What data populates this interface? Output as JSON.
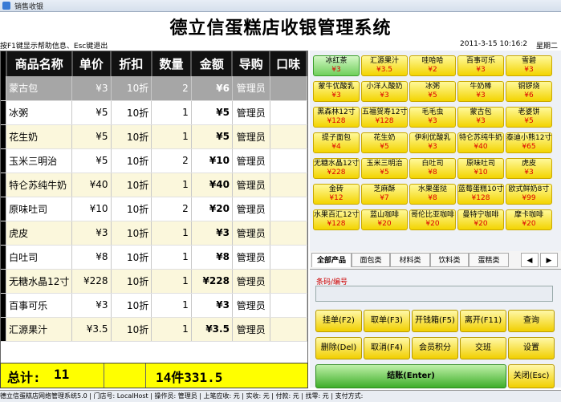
{
  "window": {
    "title": "销售收银"
  },
  "app_title": "德立信蛋糕店收银管理系统",
  "hint": "按F1键显示帮助信息、Esc键退出",
  "datetime": "2011-3-15 10:16:2",
  "weekday": "星期二",
  "grid": {
    "columns": [
      "商品名称",
      "单价",
      "折扣",
      "数量",
      "金额",
      "导购",
      "口味"
    ],
    "rows": [
      {
        "name": "蒙古包",
        "price": "¥3",
        "discount": "10折",
        "qty": "2",
        "amount": "¥6",
        "guide": "管理员",
        "flavor": ""
      },
      {
        "name": "冰粥",
        "price": "¥5",
        "discount": "10折",
        "qty": "1",
        "amount": "¥5",
        "guide": "管理员",
        "flavor": ""
      },
      {
        "name": "花生奶",
        "price": "¥5",
        "discount": "10折",
        "qty": "1",
        "amount": "¥5",
        "guide": "管理员",
        "flavor": ""
      },
      {
        "name": "玉米三明治",
        "price": "¥5",
        "discount": "10折",
        "qty": "2",
        "amount": "¥10",
        "guide": "管理员",
        "flavor": ""
      },
      {
        "name": "特仑苏纯牛奶",
        "price": "¥40",
        "discount": "10折",
        "qty": "1",
        "amount": "¥40",
        "guide": "管理员",
        "flavor": ""
      },
      {
        "name": "原味吐司",
        "price": "¥10",
        "discount": "10折",
        "qty": "2",
        "amount": "¥20",
        "guide": "管理员",
        "flavor": ""
      },
      {
        "name": "虎皮",
        "price": "¥3",
        "discount": "10折",
        "qty": "1",
        "amount": "¥3",
        "guide": "管理员",
        "flavor": ""
      },
      {
        "name": "白吐司",
        "price": "¥8",
        "discount": "10折",
        "qty": "1",
        "amount": "¥8",
        "guide": "管理员",
        "flavor": ""
      },
      {
        "name": "无糖水晶12寸",
        "price": "¥228",
        "discount": "10折",
        "qty": "1",
        "amount": "¥228",
        "guide": "管理员",
        "flavor": ""
      },
      {
        "name": "百事可乐",
        "price": "¥3",
        "discount": "10折",
        "qty": "1",
        "amount": "¥3",
        "guide": "管理员",
        "flavor": ""
      },
      {
        "name": "汇源果汁",
        "price": "¥3.5",
        "discount": "10折",
        "qty": "1",
        "amount": "¥3.5",
        "guide": "管理员",
        "flavor": ""
      }
    ]
  },
  "total": {
    "label": "总计:",
    "count": "11",
    "summary": "14件331.5"
  },
  "products": [
    {
      "name": "冰红茶",
      "price": "¥3"
    },
    {
      "name": "汇源果汁",
      "price": "¥3.5"
    },
    {
      "name": "哇哈哈",
      "price": "¥2"
    },
    {
      "name": "百事可乐",
      "price": "¥3"
    },
    {
      "name": "雪碧",
      "price": "¥3"
    },
    {
      "name": "蒙牛优酸乳",
      "price": "¥3"
    },
    {
      "name": "小洋人酸奶",
      "price": "¥3"
    },
    {
      "name": "冰粥",
      "price": "¥5"
    },
    {
      "name": "牛奶棒",
      "price": "¥3"
    },
    {
      "name": "铜锣烧",
      "price": "¥6"
    },
    {
      "name": "黑森林12寸",
      "price": "¥128"
    },
    {
      "name": "五福贺寿12寸",
      "price": "¥128"
    },
    {
      "name": "毛毛虫",
      "price": "¥3"
    },
    {
      "name": "蒙古包",
      "price": "¥3"
    },
    {
      "name": "老婆饼",
      "price": "¥5"
    },
    {
      "name": "提子面包",
      "price": "¥4"
    },
    {
      "name": "花生奶",
      "price": "¥5"
    },
    {
      "name": "伊利优酸乳",
      "price": "¥3"
    },
    {
      "name": "特仑苏纯牛奶",
      "price": "¥40"
    },
    {
      "name": "泰迪小熊12寸",
      "price": "¥65"
    },
    {
      "name": "无糖水晶12寸",
      "price": "¥228"
    },
    {
      "name": "玉米三明治",
      "price": "¥5"
    },
    {
      "name": "白吐司",
      "price": "¥8"
    },
    {
      "name": "原味吐司",
      "price": "¥10"
    },
    {
      "name": "虎皮",
      "price": "¥3"
    },
    {
      "name": "金砖",
      "price": "¥12"
    },
    {
      "name": "芝麻酥",
      "price": "¥7"
    },
    {
      "name": "水果蛋挞",
      "price": "¥8"
    },
    {
      "name": "蓝莓蛋糕10寸",
      "price": "¥128"
    },
    {
      "name": "欧式鲜奶8寸",
      "price": "¥99"
    },
    {
      "name": "水果百汇12寸",
      "price": "¥128"
    },
    {
      "name": "蓝山咖啡",
      "price": "¥20"
    },
    {
      "name": "哥伦比亚咖啡",
      "price": "¥20"
    },
    {
      "name": "曼特宁咖啡",
      "price": "¥20"
    },
    {
      "name": "摩卡咖啡",
      "price": "¥20"
    }
  ],
  "tabs": [
    "全部产品",
    "面包类",
    "材料类",
    "饮料类",
    "蛋糕类"
  ],
  "barcode_label": "条码/编号",
  "buttons": {
    "hold": "挂单(F2)",
    "retrieve": "取单(F3)",
    "cashbox": "开钱箱(F5)",
    "leave": "离开(F11)",
    "query": "查询",
    "delete": "删除(Del)",
    "cancel": "取消(F4)",
    "points": "会员积分",
    "shift": "交班",
    "settings": "设置",
    "settle": "结账(Enter)",
    "close": "关闭(Esc)"
  },
  "status_bar": "德立信蛋糕店网络管理系统5.0 | 门店号: LocalHost | 操作员: 管理员 | 上笔应收: 元 | 实收: 元 | 付款: 元 | 找零: 元 | 支付方式:"
}
